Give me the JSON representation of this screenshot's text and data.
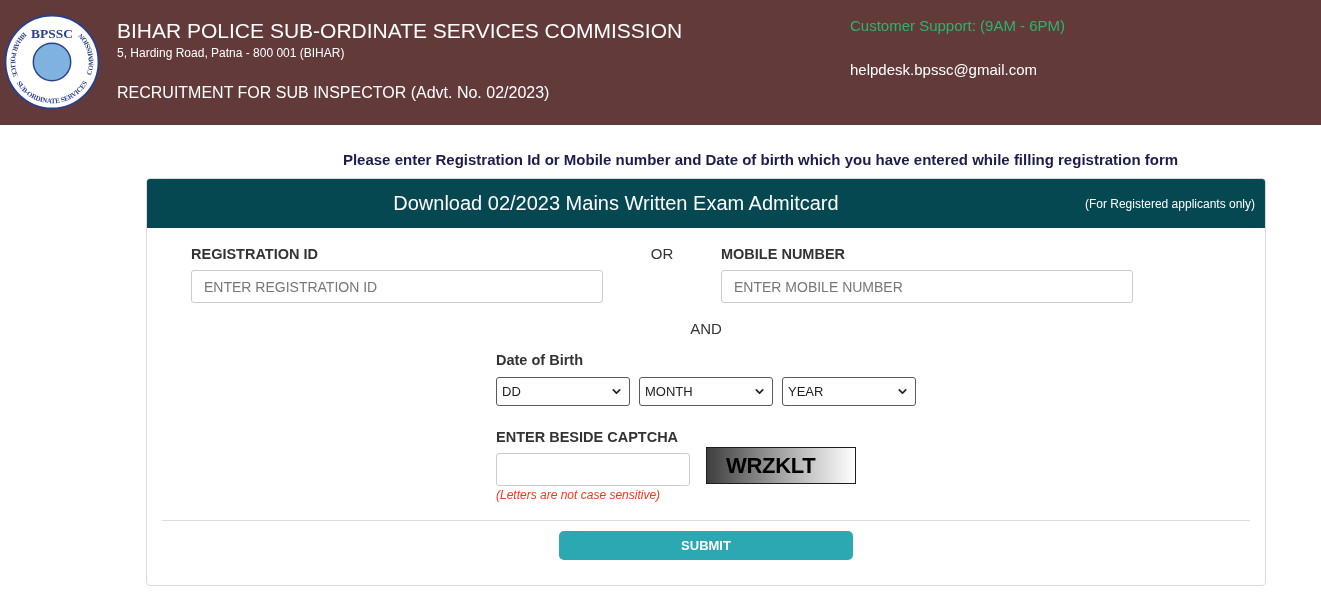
{
  "header": {
    "logo": {
      "monogram": "BPSSC",
      "ring_text": [
        "BIHAR POLICE",
        "SUB-ORDINATE SERVICES",
        "COMMISSION"
      ]
    },
    "title": "BIHAR POLICE SUB-ORDINATE SERVICES COMMISSION",
    "address": "5, Harding Road, Patna - 800 001 (BIHAR)",
    "recruitment": "RECRUITMENT FOR SUB INSPECTOR (Advt. No. 02/2023)",
    "support": {
      "hours": "Customer Support: (9AM - 6PM)",
      "email": "helpdesk.bpssc@gmail.com"
    }
  },
  "instruction": "Please enter Registration Id or Mobile number and Date of birth which you have entered while filling registration form",
  "card": {
    "title": "Download 02/2023 Mains Written Exam Admitcard",
    "note": "(For Registered applicants only)",
    "fields": [
      {
        "label": "REGISTRATION ID",
        "placeholder": "ENTER REGISTRATION ID"
      },
      {
        "label": "MOBILE NUMBER",
        "placeholder": "ENTER MOBILE NUMBER"
      }
    ],
    "or_text": "OR",
    "and_text": "AND",
    "dob": {
      "label": "Date of Birth",
      "selects": [
        {
          "value": "DD"
        },
        {
          "value": "MONTH"
        },
        {
          "value": "YEAR"
        }
      ]
    },
    "captcha": {
      "label": "ENTER BESIDE CAPTCHA",
      "code": "WRZKLT",
      "hint": "(Letters are not case sensitive)"
    },
    "submit": "SUBMIT"
  }
}
